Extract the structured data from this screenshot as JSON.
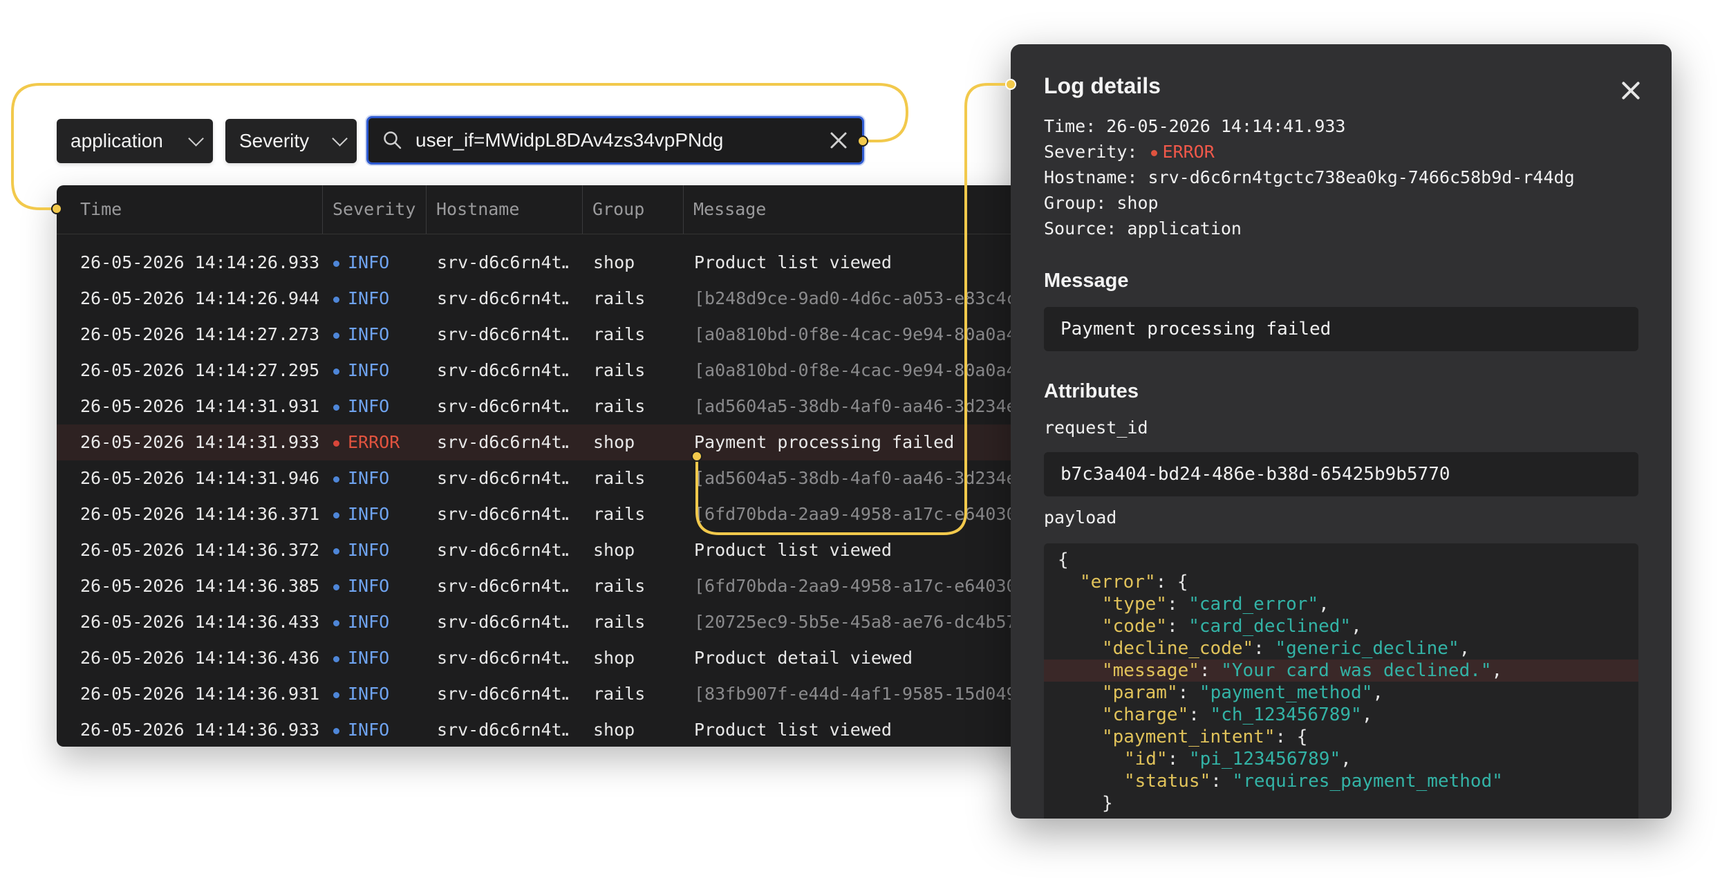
{
  "filters": {
    "source": "application",
    "severity": "Severity",
    "search_value": "user_if=MWidpL8DAv4zs34vpPNdg"
  },
  "table": {
    "headers": [
      "Time",
      "Severity",
      "Hostname",
      "Group",
      "Message"
    ],
    "rows": [
      {
        "time": "26-05-2026 14:14:26.933",
        "severity": "INFO",
        "host": "srv-d6c6rn4t…",
        "group": "shop",
        "message": "Product list viewed"
      },
      {
        "time": "26-05-2026 14:14:26.944",
        "severity": "INFO",
        "host": "srv-d6c6rn4t…",
        "group": "rails",
        "message": "[b248d9ce-9ad0-4d6c-a053-e83c4c"
      },
      {
        "time": "26-05-2026 14:14:27.273",
        "severity": "INFO",
        "host": "srv-d6c6rn4t…",
        "group": "rails",
        "message": "[a0a810bd-0f8e-4cac-9e94-80a0a4"
      },
      {
        "time": "26-05-2026 14:14:27.295",
        "severity": "INFO",
        "host": "srv-d6c6rn4t…",
        "group": "rails",
        "message": "[a0a810bd-0f8e-4cac-9e94-80a0a4"
      },
      {
        "time": "26-05-2026 14:14:31.931",
        "severity": "INFO",
        "host": "srv-d6c6rn4t…",
        "group": "rails",
        "message": "[ad5604a5-38db-4af0-aa46-3d234e"
      },
      {
        "time": "26-05-2026 14:14:31.933",
        "severity": "ERROR",
        "host": "srv-d6c6rn4t…",
        "group": "shop",
        "message": "Payment processing failed"
      },
      {
        "time": "26-05-2026 14:14:31.946",
        "severity": "INFO",
        "host": "srv-d6c6rn4t…",
        "group": "rails",
        "message": "[ad5604a5-38db-4af0-aa46-3d234e"
      },
      {
        "time": "26-05-2026 14:14:36.371",
        "severity": "INFO",
        "host": "srv-d6c6rn4t…",
        "group": "rails",
        "message": "[6fd70bda-2aa9-4958-a17c-e64030"
      },
      {
        "time": "26-05-2026 14:14:36.372",
        "severity": "INFO",
        "host": "srv-d6c6rn4t…",
        "group": "shop",
        "message": "Product list viewed"
      },
      {
        "time": "26-05-2026 14:14:36.385",
        "severity": "INFO",
        "host": "srv-d6c6rn4t…",
        "group": "rails",
        "message": "[6fd70bda-2aa9-4958-a17c-e64030"
      },
      {
        "time": "26-05-2026 14:14:36.433",
        "severity": "INFO",
        "host": "srv-d6c6rn4t…",
        "group": "rails",
        "message": "[20725ec9-5b5e-45a8-ae76-dc4b57"
      },
      {
        "time": "26-05-2026 14:14:36.436",
        "severity": "INFO",
        "host": "srv-d6c6rn4t…",
        "group": "shop",
        "message": "Product detail viewed"
      },
      {
        "time": "26-05-2026 14:14:36.931",
        "severity": "INFO",
        "host": "srv-d6c6rn4t…",
        "group": "rails",
        "message": "[83fb907f-e44d-4af1-9585-15d049"
      },
      {
        "time": "26-05-2026 14:14:36.933",
        "severity": "INFO",
        "host": "srv-d6c6rn4t…",
        "group": "shop",
        "message": "Product list viewed"
      }
    ]
  },
  "details": {
    "title": "Log details",
    "time": "Time: 26-05-2026 14:14:41.933",
    "severity_label": "Severity:",
    "severity_value": "ERROR",
    "hostname": "Hostname: srv-d6c6rn4tgctc738ea0kg-7466c58b9d-r44dg",
    "group": "Group: shop",
    "source": "Source: application",
    "message_heading": "Message",
    "message": "Payment processing failed",
    "attributes_heading": "Attributes",
    "request_id_label": "request_id",
    "request_id": "b7c3a404-bd24-486e-b38d-65425b9b5770",
    "payload_label": "payload",
    "payload_lines": [
      {
        "indent": 0,
        "text": "{"
      },
      {
        "indent": 1,
        "key": "error",
        "open": "{"
      },
      {
        "indent": 2,
        "key": "type",
        "value": "card_error"
      },
      {
        "indent": 2,
        "key": "code",
        "value": "card_declined"
      },
      {
        "indent": 2,
        "key": "decline_code",
        "value": "generic_decline"
      },
      {
        "indent": 2,
        "key": "message",
        "value": "Your card was declined.",
        "highlight": true
      },
      {
        "indent": 2,
        "key": "param",
        "value": "payment_method"
      },
      {
        "indent": 2,
        "key": "charge",
        "value": "ch_123456789"
      },
      {
        "indent": 2,
        "key": "payment_intent",
        "open": "{"
      },
      {
        "indent": 3,
        "key": "id",
        "value": "pi_123456789"
      },
      {
        "indent": 3,
        "key": "status",
        "value": "requires_payment_method",
        "last": true
      },
      {
        "indent": 2,
        "text": "}"
      }
    ]
  },
  "colors": {
    "accent_connector": "#f2c94c",
    "search_border": "#2f5bd1",
    "info": "#6fa3ef",
    "error": "#e0533f"
  }
}
